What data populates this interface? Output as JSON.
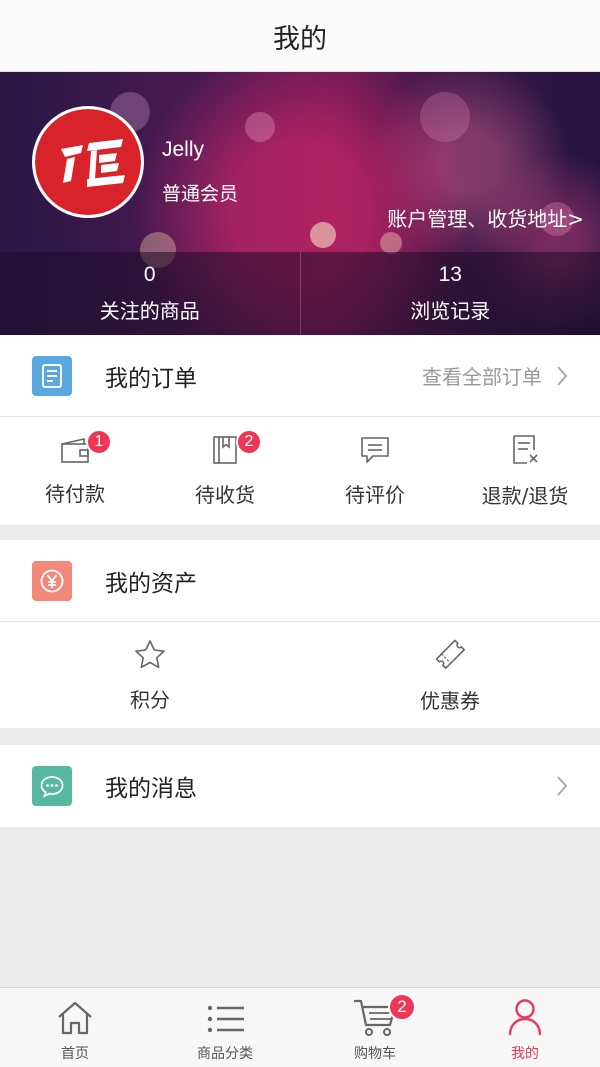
{
  "header": {
    "title": "我的"
  },
  "profile": {
    "name": "Jelly",
    "level": "普通会员",
    "account_link": "账户管理、收货地址>",
    "avatar_icon": "brand-logo-icon",
    "stats": [
      {
        "value": "0",
        "label": "关注的商品"
      },
      {
        "value": "13",
        "label": "浏览记录"
      }
    ]
  },
  "orders": {
    "title": "我的订单",
    "view_all": "查看全部订单",
    "icon": "order-list-icon",
    "icon_color": "#5aa8e0",
    "items": [
      {
        "label": "待付款",
        "badge": "1",
        "icon": "wallet-icon"
      },
      {
        "label": "待收货",
        "badge": "2",
        "icon": "book-icon"
      },
      {
        "label": "待评价",
        "icon": "comment-icon"
      },
      {
        "label": "退款/退货",
        "icon": "refund-icon"
      }
    ]
  },
  "assets": {
    "title": "我的资产",
    "icon": "yen-icon",
    "icon_color": "#f2897b",
    "items": [
      {
        "label": "积分",
        "icon": "star-icon"
      },
      {
        "label": "优惠券",
        "icon": "ticket-icon"
      }
    ]
  },
  "messages": {
    "title": "我的消息",
    "icon": "chat-icon",
    "icon_color": "#57b8a0"
  },
  "tabbar": {
    "items": [
      {
        "label": "首页",
        "icon": "home-icon"
      },
      {
        "label": "商品分类",
        "icon": "list-icon"
      },
      {
        "label": "购物车",
        "icon": "cart-icon",
        "badge": "2"
      },
      {
        "label": "我的",
        "icon": "user-icon",
        "active": true
      }
    ],
    "accent_color": "#e8385c"
  }
}
